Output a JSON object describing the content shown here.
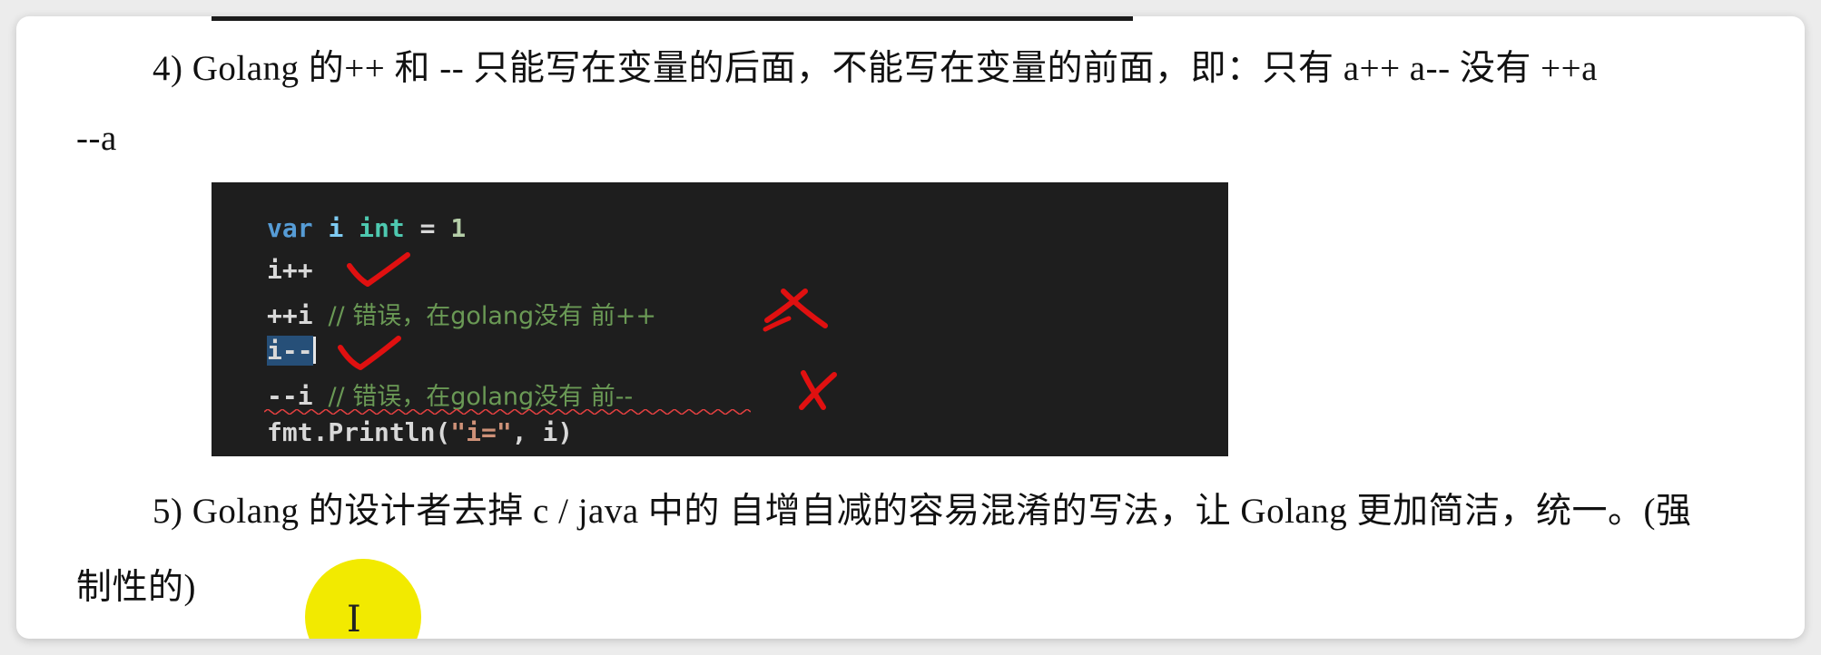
{
  "paragraph4": {
    "line1": "4) Golang 的++ 和 -- 只能写在变量的后面，不能写在变量的前面，即：只有 a++ a-- 没有 ++a",
    "line2": "--a"
  },
  "code": {
    "line1": {
      "kw": "var",
      "ident": "i",
      "type": "int",
      "op": " = ",
      "num": "1"
    },
    "line2": "i++",
    "line3": {
      "code": "++i",
      "comment": "// 错误，在golang没有 前++"
    },
    "line4": "i--",
    "line5": {
      "code": "--i",
      "comment": "// 错误，在golang没有 前--"
    },
    "line6": {
      "call": "fmt.Println(",
      "str": "\"i=\"",
      "rest": ", i)"
    }
  },
  "paragraph5": {
    "line1": "5) Golang 的设计者去掉 c / java 中的 自增自减的容易混淆的写法，让 Golang 更加简洁，统一。(强",
    "line2": "制性的)"
  },
  "annotations": {
    "check_color": "#e01010",
    "cross_color": "#e01010"
  },
  "cursor": {
    "highlight_color": "#f2ea00",
    "glyph": "I"
  }
}
